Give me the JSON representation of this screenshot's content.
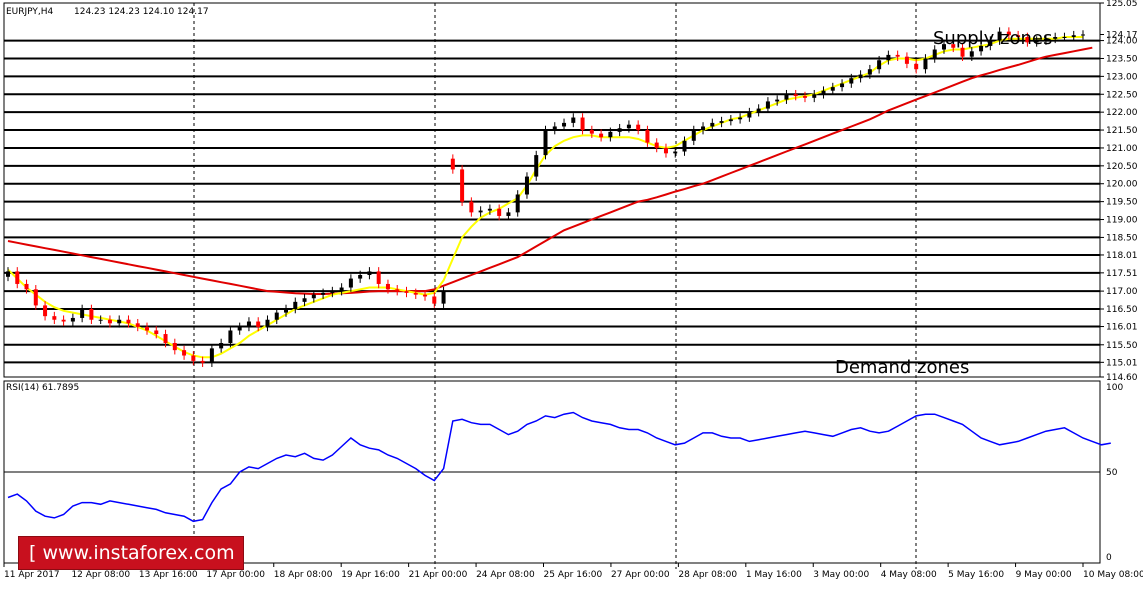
{
  "header": {
    "symbol": "EURJPY,H4",
    "ohlc": "124.23 124.23 124.10 124.17"
  },
  "annotations": {
    "supply": "Supply zones",
    "demand": "Demand zones"
  },
  "rsi_label": "RSI(14) 61.7895",
  "brand": "[ www.instaforex.com ]",
  "colors": {
    "bull_candle": "#000000",
    "bear_candle": "#ff0000",
    "fast_ma": "#ffff00",
    "slow_ma": "#e00000",
    "rsi": "#0000ff",
    "zone_lines": "#000000",
    "brand_bg": "#c8101e"
  },
  "chart_data": [
    {
      "type": "line",
      "title": "",
      "price_axis": {
        "ylim": [
          114.6,
          125.05
        ],
        "ticks": [
          "125.05",
          "124.17",
          "124.00",
          "123.50",
          "123.00",
          "122.50",
          "122.00",
          "121.50",
          "121.00",
          "120.50",
          "120.00",
          "119.50",
          "119.00",
          "118.50",
          "118.01",
          "117.51",
          "117.00",
          "116.50",
          "116.01",
          "115.50",
          "115.01",
          "114.60"
        ]
      },
      "zone_levels": [
        124.0,
        123.5,
        123.0,
        122.5,
        122.0,
        121.5,
        121.0,
        120.5,
        120.0,
        119.5,
        119.0,
        118.5,
        118.01,
        117.51,
        117.0,
        116.5,
        116.01,
        115.5,
        115.01
      ],
      "x_labels": [
        "11 Apr 2017",
        "12 Apr 08:00",
        "13 Apr 16:00",
        "17 Apr 00:00",
        "18 Apr 08:00",
        "19 Apr 16:00",
        "21 Apr 00:00",
        "24 Apr 08:00",
        "25 Apr 16:00",
        "27 Apr 00:00",
        "28 Apr 08:00",
        "1 May 16:00",
        "3 May 00:00",
        "4 May 08:00",
        "5 May 16:00",
        "9 May 00:00",
        "10 May 08:00"
      ],
      "candle_close": [
        117.55,
        117.2,
        117.05,
        116.6,
        116.3,
        116.2,
        116.15,
        116.25,
        116.5,
        116.2,
        116.2,
        116.1,
        116.2,
        116.1,
        116.0,
        115.9,
        115.8,
        115.55,
        115.35,
        115.2,
        115.05,
        115.0,
        115.4,
        115.55,
        115.9,
        116.0,
        116.15,
        116.0,
        116.2,
        116.4,
        116.5,
        116.7,
        116.8,
        116.9,
        116.95,
        117.0,
        117.1,
        117.35,
        117.45,
        117.55,
        117.2,
        117.05,
        117.0,
        116.95,
        116.9,
        116.85,
        116.65,
        117.0,
        120.4,
        119.5,
        119.2,
        119.25,
        119.3,
        119.1,
        119.2,
        119.7,
        120.2,
        120.8,
        121.5,
        121.6,
        121.7,
        121.85,
        121.5,
        121.4,
        121.3,
        121.45,
        121.55,
        121.65,
        121.5,
        121.15,
        121.0,
        120.85,
        120.9,
        121.2,
        121.5,
        121.6,
        121.7,
        121.75,
        121.8,
        121.85,
        122.0,
        122.1,
        122.3,
        122.35,
        122.5,
        122.45,
        122.4,
        122.5,
        122.6,
        122.7,
        122.8,
        122.95,
        123.05,
        123.2,
        123.45,
        123.6,
        123.55,
        123.35,
        123.2,
        123.5,
        123.75,
        123.9,
        123.8,
        123.55,
        123.7,
        123.85,
        124.0,
        124.25,
        124.15,
        124.1,
        123.95,
        124.0,
        124.05,
        124.1,
        124.1,
        124.15,
        124.17
      ],
      "candle_open": [
        117.4,
        117.55,
        117.2,
        117.05,
        116.6,
        116.3,
        116.2,
        116.15,
        116.25,
        116.5,
        116.2,
        116.2,
        116.1,
        116.2,
        116.1,
        116.0,
        115.9,
        115.8,
        115.55,
        115.35,
        115.2,
        115.05,
        115.0,
        115.4,
        115.55,
        115.9,
        116.0,
        116.15,
        116.0,
        116.2,
        116.4,
        116.5,
        116.7,
        116.8,
        116.9,
        116.95,
        117.0,
        117.1,
        117.35,
        117.45,
        117.55,
        117.2,
        117.05,
        117.0,
        116.95,
        116.9,
        116.85,
        116.65,
        120.7,
        120.4,
        119.5,
        119.2,
        119.25,
        119.3,
        119.1,
        119.2,
        119.7,
        120.2,
        120.8,
        121.5,
        121.6,
        121.7,
        121.85,
        121.5,
        121.4,
        121.3,
        121.45,
        121.55,
        121.65,
        121.5,
        121.15,
        121.0,
        120.85,
        120.9,
        121.2,
        121.5,
        121.6,
        121.7,
        121.75,
        121.8,
        121.85,
        122.0,
        122.1,
        122.3,
        122.35,
        122.5,
        122.45,
        122.4,
        122.5,
        122.6,
        122.7,
        122.8,
        122.95,
        123.05,
        123.2,
        123.45,
        123.6,
        123.55,
        123.35,
        123.2,
        123.5,
        123.75,
        123.9,
        123.8,
        123.55,
        123.7,
        123.85,
        124.0,
        124.25,
        124.15,
        124.1,
        123.95,
        124.0,
        124.05,
        124.1,
        124.1,
        124.15
      ],
      "fast_ma": [
        117.6,
        117.35,
        117.1,
        116.9,
        116.7,
        116.55,
        116.45,
        116.4,
        116.35,
        116.3,
        116.25,
        116.2,
        116.15,
        116.1,
        116.0,
        115.9,
        115.75,
        115.6,
        115.45,
        115.3,
        115.2,
        115.15,
        115.15,
        115.25,
        115.4,
        115.55,
        115.75,
        115.9,
        116.05,
        116.2,
        116.35,
        116.5,
        116.6,
        116.7,
        116.8,
        116.9,
        116.95,
        117.0,
        117.05,
        117.1,
        117.1,
        117.1,
        117.05,
        117.0,
        116.95,
        116.9,
        116.95,
        117.3,
        117.9,
        118.5,
        118.8,
        119.05,
        119.2,
        119.3,
        119.45,
        119.6,
        119.95,
        120.4,
        120.8,
        121.05,
        121.2,
        121.3,
        121.35,
        121.35,
        121.3,
        121.3,
        121.3,
        121.3,
        121.25,
        121.15,
        121.05,
        121.0,
        121.05,
        121.2,
        121.35,
        121.5,
        121.6,
        121.7,
        121.8,
        121.85,
        121.95,
        122.05,
        122.15,
        122.25,
        122.35,
        122.4,
        122.45,
        122.5,
        122.6,
        122.7,
        122.8,
        122.9,
        123.0,
        123.1,
        123.3,
        123.45,
        123.5,
        123.5,
        123.45,
        123.5,
        123.6,
        123.7,
        123.75,
        123.75,
        123.8,
        123.85,
        123.9,
        124.0,
        124.05,
        124.05,
        124.05,
        124.05,
        124.05,
        124.05,
        124.1,
        124.1,
        124.1
      ],
      "slow_ma": [
        118.4,
        118.35,
        118.3,
        118.25,
        118.2,
        118.15,
        118.1,
        118.05,
        118.0,
        117.95,
        117.9,
        117.85,
        117.8,
        117.75,
        117.7,
        117.65,
        117.6,
        117.55,
        117.5,
        117.45,
        117.4,
        117.35,
        117.3,
        117.25,
        117.2,
        117.15,
        117.1,
        117.05,
        117.0,
        116.98,
        116.96,
        116.94,
        116.93,
        116.92,
        116.92,
        116.93,
        116.94,
        116.95,
        116.97,
        116.99,
        117.0,
        117.0,
        117.0,
        117.0,
        117.0,
        117.0,
        117.05,
        117.15,
        117.25,
        117.35,
        117.45,
        117.55,
        117.65,
        117.75,
        117.85,
        117.95,
        118.1,
        118.25,
        118.4,
        118.55,
        118.7,
        118.8,
        118.9,
        119.0,
        119.1,
        119.2,
        119.3,
        119.4,
        119.5,
        119.55,
        119.62,
        119.7,
        119.78,
        119.85,
        119.93,
        120.0,
        120.1,
        120.2,
        120.3,
        120.4,
        120.5,
        120.6,
        120.7,
        120.8,
        120.9,
        121.0,
        121.1,
        121.2,
        121.3,
        121.4,
        121.5,
        121.6,
        121.7,
        121.8,
        121.92,
        122.05,
        122.15,
        122.25,
        122.35,
        122.45,
        122.55,
        122.65,
        122.75,
        122.85,
        122.95,
        123.03,
        123.1,
        123.18,
        123.25,
        123.32,
        123.4,
        123.48,
        123.55,
        123.6,
        123.65,
        123.7,
        123.75,
        123.8
      ]
    },
    {
      "type": "line",
      "title": "RSI(14) 61.7895",
      "ylim": [
        0,
        100
      ],
      "level": 50,
      "tick_labels": [
        "100",
        "50",
        "0"
      ],
      "series": [
        {
          "values": [
            35,
            37,
            33,
            27,
            24,
            23,
            25,
            30,
            32,
            32,
            31,
            33,
            32,
            31,
            30,
            29,
            28,
            26,
            25,
            24,
            21,
            22,
            32,
            40,
            43,
            50,
            53,
            52,
            55,
            58,
            60,
            59,
            61,
            58,
            57,
            60,
            65,
            70,
            66,
            64,
            63,
            60,
            58,
            55,
            52,
            48,
            45,
            52,
            80,
            81,
            79,
            78,
            78,
            75,
            72,
            74,
            78,
            80,
            83,
            82,
            84,
            85,
            82,
            80,
            79,
            78,
            76,
            75,
            75,
            73,
            70,
            68,
            66,
            67,
            70,
            73,
            73,
            71,
            70,
            70,
            68,
            69,
            70,
            71,
            72,
            73,
            74,
            73,
            72,
            71,
            73,
            75,
            76,
            74,
            73,
            74,
            77,
            80,
            83,
            84,
            84,
            82,
            80,
            78,
            74,
            70,
            68,
            66,
            67,
            68,
            70,
            72,
            74,
            75,
            76,
            73,
            70,
            68,
            66,
            67
          ],
          "color": "blue"
        }
      ]
    }
  ]
}
